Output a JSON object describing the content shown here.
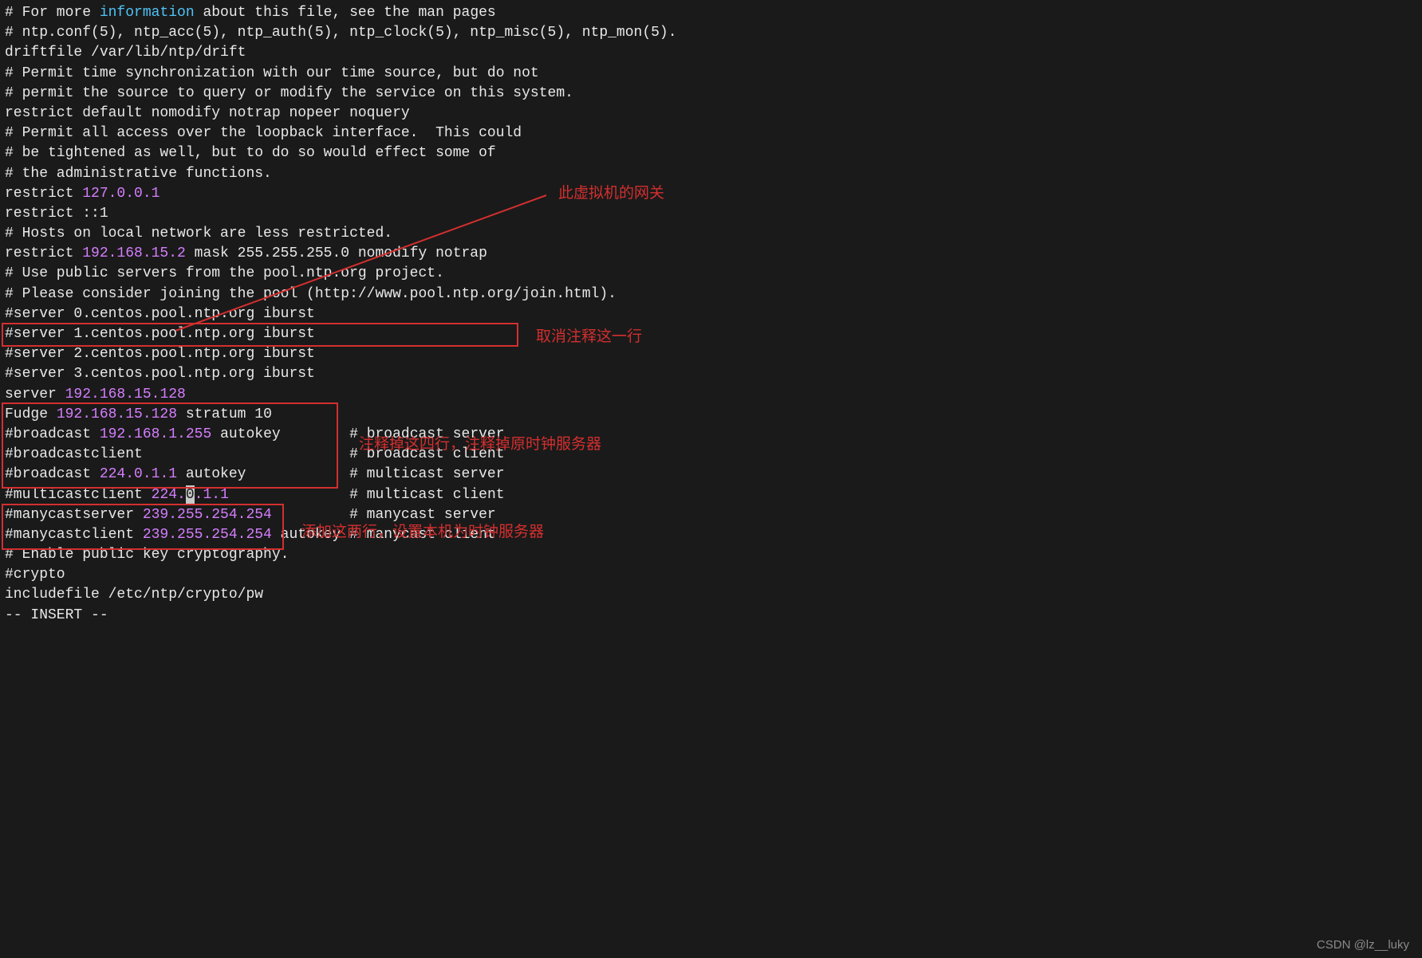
{
  "lines": {
    "l1a": "# For more ",
    "l1b": "information",
    "l1c": " about this file, see the man pages",
    "l2": "# ntp.conf(5), ntp_acc(5), ntp_auth(5), ntp_clock(5), ntp_misc(5), ntp_mon(5).",
    "l3": "",
    "l4": "driftfile /var/lib/ntp/drift",
    "l5": "",
    "l6": "# Permit time synchronization with our time source, but do not",
    "l7": "# permit the source to query or modify the service on this system.",
    "l8": "restrict default nomodify notrap nopeer noquery",
    "l9": "",
    "l10": "# Permit all access over the loopback interface.  This could",
    "l11": "# be tightened as well, but to do so would effect some of",
    "l12": "# the administrative functions.",
    "l13a": "restrict ",
    "l13b": "127.0.0.1",
    "l14": "restrict ::1",
    "l15": "",
    "l16": "# Hosts on local network are less restricted.",
    "l17a": "restrict ",
    "l17b": "192.168.15.2",
    "l17c": " mask 255.255.255.0 nomodify notrap",
    "l18": "",
    "l19": "# Use public servers from the pool.ntp.org project.",
    "l20": "# Please consider joining the pool (http://www.pool.ntp.org/join.html).",
    "l21": "#server 0.centos.pool.ntp.org iburst",
    "l22": "#server 1.centos.pool.ntp.org iburst",
    "l23": "#server 2.centos.pool.ntp.org iburst",
    "l24": "#server 3.centos.pool.ntp.org iburst",
    "l25": "",
    "l26a": "server ",
    "l26b": "192.168.15.128",
    "l27a": "Fudge ",
    "l27b": "192.168.15.128",
    "l27c": " stratum 10",
    "l28": "",
    "l29a": "#broadcast ",
    "l29b": "192.168.1.255",
    "l29c": " autokey        # broadcast server",
    "l30": "#broadcastclient                        # broadcast client",
    "l31a": "#broadcast ",
    "l31b": "224.0.1.1",
    "l31c": " autokey            # multicast server",
    "l32a": "#multicastclient ",
    "l32b": "224.",
    "l32c": "0",
    "l32d": ".1.1",
    "l32e": "              # multicast client",
    "l33a": "#manycastserver ",
    "l33b": "239.255.254.254",
    "l33c": "         # manycast server",
    "l34a": "#manycastclient ",
    "l34b": "239.255.254.254",
    "l34c": " autokey # manycast client",
    "l35": "",
    "l36": "# Enable public key cryptography.",
    "l37": "#crypto",
    "l38": "",
    "l39": "includefile /etc/ntp/crypto/pw",
    "l40": "",
    "mode": "-- INSERT --"
  },
  "annotations": {
    "a1": "此虚拟机的网关",
    "a2": "取消注释这一行",
    "a3": "注释掉这四行，注释掉原时钟服务器",
    "a4": "添加这两行，设置本机为时钟服务器"
  },
  "watermark": "CSDN @lz__luky"
}
